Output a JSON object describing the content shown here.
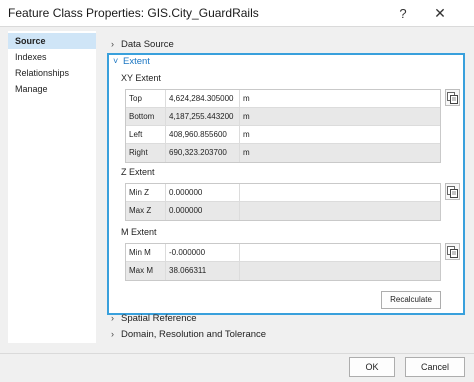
{
  "window": {
    "title": "Feature Class Properties: GIS.City_GuardRails",
    "help_glyph": "?",
    "close_glyph": "✕"
  },
  "sidebar": {
    "items": [
      {
        "label": "Source",
        "active": true
      },
      {
        "label": "Indexes",
        "active": false
      },
      {
        "label": "Relationships",
        "active": false
      },
      {
        "label": "Manage",
        "active": false
      }
    ]
  },
  "sections": {
    "data_source": "Data Source",
    "extent": "Extent",
    "spatial_reference": "Spatial Reference",
    "domain": "Domain, Resolution and Tolerance"
  },
  "icons": {
    "collapsed": "chevron-right-icon",
    "expanded": "chevron-down-icon",
    "copy": "copy-icon"
  },
  "colors": {
    "accent_border": "#39a0dc",
    "extent_title": "#1b76c2",
    "active_tab": "#cfe5f7"
  },
  "extent": {
    "xy": {
      "label": "XY Extent",
      "rows": [
        {
          "label": "Top",
          "value": "4,624,284.305000",
          "unit": "m"
        },
        {
          "label": "Bottom",
          "value": "4,187,255.443200",
          "unit": "m"
        },
        {
          "label": "Left",
          "value": "408,960.855600",
          "unit": "m"
        },
        {
          "label": "Right",
          "value": "690,323.203700",
          "unit": "m"
        }
      ]
    },
    "z": {
      "label": "Z Extent",
      "rows": [
        {
          "label": "Min Z",
          "value": "0.000000",
          "unit": ""
        },
        {
          "label": "Max Z",
          "value": "0.000000",
          "unit": ""
        }
      ]
    },
    "m": {
      "label": "M Extent",
      "rows": [
        {
          "label": "Min M",
          "value": "-0.000000",
          "unit": ""
        },
        {
          "label": "Max M",
          "value": "38.066311",
          "unit": ""
        }
      ]
    },
    "recalculate_label": "Recalculate"
  },
  "footer": {
    "ok_label": "OK",
    "cancel_label": "Cancel"
  }
}
